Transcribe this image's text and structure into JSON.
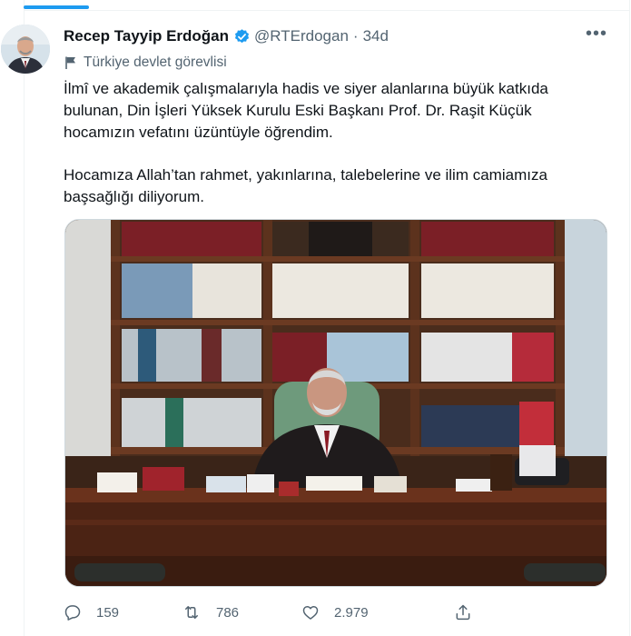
{
  "tweet": {
    "author_name": "Recep Tayyip Erdoğan",
    "handle": "@RTErdogan",
    "separator": "·",
    "time": "34d",
    "more_label": "•••",
    "account_label": "Türkiye devlet görevlisi",
    "text_paragraph_1": "İlmî ve akademik çalışmalarıyla hadis ve siyer alanlarına büyük katkıda bulunan, Din İşleri Yüksek Kurulu Eski Başkanı Prof. Dr. Raşit Küçük hocamızın vefatını üzüntüyle öğrendim.",
    "text_paragraph_2": "Hocamıza Allah’tan rahmet, yakınlarına, talebelerine ve ilim camiamıza başsağlığı diliyorum."
  },
  "stats": {
    "replies": "159",
    "retweets": "786",
    "likes": "2.979"
  },
  "icons": {
    "verified": "verified-badge-icon",
    "label": "flag-icon",
    "reply": "comment-icon",
    "retweet": "retweet-icon",
    "like": "heart-icon",
    "share": "share-icon",
    "more": "more-dots-icon"
  },
  "colors": {
    "accent": "#1d9bf0",
    "secondary_text": "#536471",
    "primary_text": "#0f1419"
  }
}
